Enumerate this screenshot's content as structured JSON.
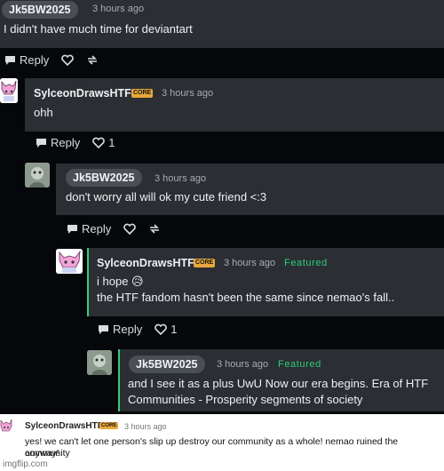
{
  "comments": [
    {
      "user": "Jk5BW2025",
      "time": "3 hours ago",
      "lines": [
        "I didn't have much time for deviantart"
      ]
    },
    {
      "user": "SylceonDrawsHTF",
      "badge": "CORE",
      "time": "3 hours ago",
      "lines": [
        "ohh"
      ],
      "likes": "1"
    },
    {
      "user": "Jk5BW2025",
      "time": "3 hours ago",
      "lines": [
        "don't worry all will ok my cute friend <:3"
      ]
    },
    {
      "user": "SylceonDrawsHTF",
      "badge": "CORE",
      "time": "3 hours ago",
      "featured": "Featured",
      "lines": [
        "i hope 😥",
        "the HTF fandom hasn't been the same since nemao's fall.."
      ],
      "likes": "1"
    },
    {
      "user": "Jk5BW2025",
      "time": "3 hours ago",
      "featured": "Featured",
      "lines": [
        "and I see it as a plus UwU Now our era begins. Era of HTF",
        "Communities - Prosperity segments of society"
      ]
    },
    {
      "user": "SylceonDrawsHTF",
      "badge": "CORE",
      "time": "3 hours ago",
      "lines": [
        "yes! we can't let one person's slip up destroy our community as a whole! nemao ruined the community",
        "anyway!"
      ]
    }
  ],
  "reply_label": "Reply",
  "watermark": "imgflip.com",
  "colors": {
    "featured": "#2ecf7a",
    "core_badge": "#e9a73b",
    "card": "#2b2e33"
  },
  "icons": [
    "comment-icon",
    "heart-icon",
    "share-icon"
  ]
}
